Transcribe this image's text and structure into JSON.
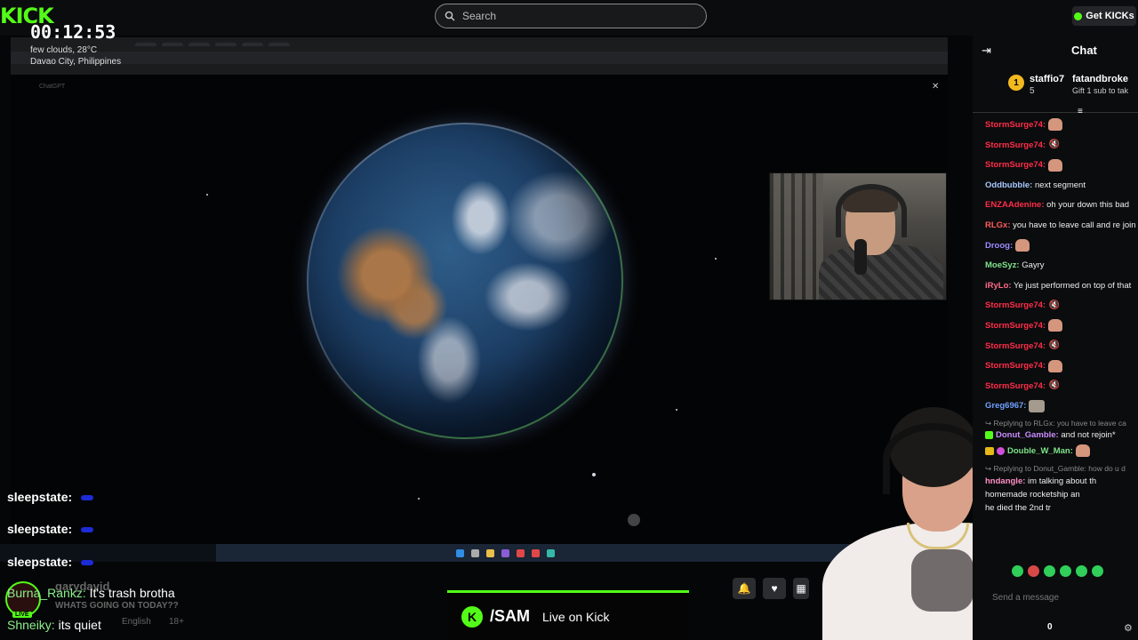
{
  "topbar": {
    "logo_text": "KICK",
    "search_placeholder": "Search",
    "get_kicks_label": "Get KICKs"
  },
  "overlay": {
    "timer": "00:12:53",
    "weather_line1": "few clouds, 28°C",
    "weather_line2": "Davao City, Philippines"
  },
  "stream_chat": [
    {
      "user": "sleepstate:",
      "emote": "blue-emote"
    },
    {
      "user": "sleepstate:",
      "emote": "blue-emote"
    },
    {
      "user": "sleepstate:",
      "emote": "blue-emote"
    }
  ],
  "stream_chat2": [
    {
      "user": "Burna_Rankz:",
      "text": "It's trash brotha"
    },
    {
      "user": "Shneiky:",
      "text": "its quiet"
    }
  ],
  "ghost_text": {
    "name": "garydavid",
    "question": "WHATS GOING ON TODAY??",
    "language": "English",
    "age": "18+"
  },
  "live_badge": "LIVE",
  "live_bar": {
    "k": "K",
    "name": "/SAM",
    "status": "Live on Kick"
  },
  "chat": {
    "title": "Chat",
    "pinned": {
      "user1": "staffio7",
      "count1": "5",
      "user2": "fatandbroke",
      "sub_text": "Gift 1 sub to tak"
    },
    "messages": [
      {
        "user": "StormSurge74:",
        "color": "#ff2d4a",
        "emote": "hand"
      },
      {
        "user": "StormSurge74:",
        "color": "#ff2d4a",
        "emote": "mute"
      },
      {
        "user": "StormSurge74:",
        "color": "#ff2d4a",
        "emote": "hand"
      },
      {
        "user": "Oddbubble:",
        "color": "#a8c8ff",
        "text": "next segment"
      },
      {
        "user": "ENZAAdenine:",
        "color": "#ff2d4a",
        "text": "oh your down this bad"
      },
      {
        "user": "RLGx:",
        "color": "#ff5a5a",
        "text": "you have to leave call and re join"
      },
      {
        "user": "Droog:",
        "color": "#9a8cff",
        "emote": "hand"
      },
      {
        "user": "MoeSyz:",
        "color": "#7de38a",
        "text": "Gayry"
      },
      {
        "user": "iRyLo:",
        "color": "#ff6b8a",
        "text": "Ye just performed on top of that"
      },
      {
        "user": "StormSurge74:",
        "color": "#ff2d4a",
        "emote": "mute"
      },
      {
        "user": "StormSurge74:",
        "color": "#ff2d4a",
        "emote": "hand"
      },
      {
        "user": "StormSurge74:",
        "color": "#ff2d4a",
        "emote": "mute"
      },
      {
        "user": "StormSurge74:",
        "color": "#ff2d4a",
        "emote": "hand"
      },
      {
        "user": "StormSurge74:",
        "color": "#ff2d4a",
        "emote": "mute"
      },
      {
        "user": "Greg6967:",
        "color": "#6fa0ff",
        "emote": "face"
      }
    ],
    "reply1": "Replying to RLGx: you have to leave ca",
    "donut_user": "Donut_Gamble:",
    "donut_text": "and not rejoin*",
    "double_user": "Double_W_Man:",
    "reply2": "Replying to Donut_Gamble: how do u d",
    "ndangle_user": "hndangle:",
    "ndangle_text": "im talking about th",
    "ndangle_text2": "homemade rocketship an",
    "ndangle_text3": "he died the 2nd tr",
    "input_placeholder": "Send a message",
    "count": "0"
  },
  "colors": {
    "kick_green": "#53fc18"
  }
}
